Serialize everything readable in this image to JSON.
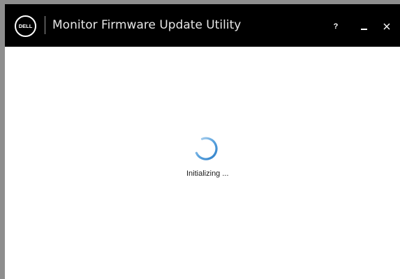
{
  "window": {
    "title": "Monitor Firmware Update Utility",
    "logo_text": "DELL",
    "controls": {
      "help_label": "?",
      "minimize_icon": "minimize-icon",
      "close_icon": "close-icon"
    }
  },
  "main": {
    "spinner_icon": "loading-spinner-icon",
    "status_text": "Initializing ..."
  },
  "colors": {
    "titlebar": "#000000",
    "content_bg": "#ffffff",
    "spinner_accent": "#3a8fd6"
  }
}
